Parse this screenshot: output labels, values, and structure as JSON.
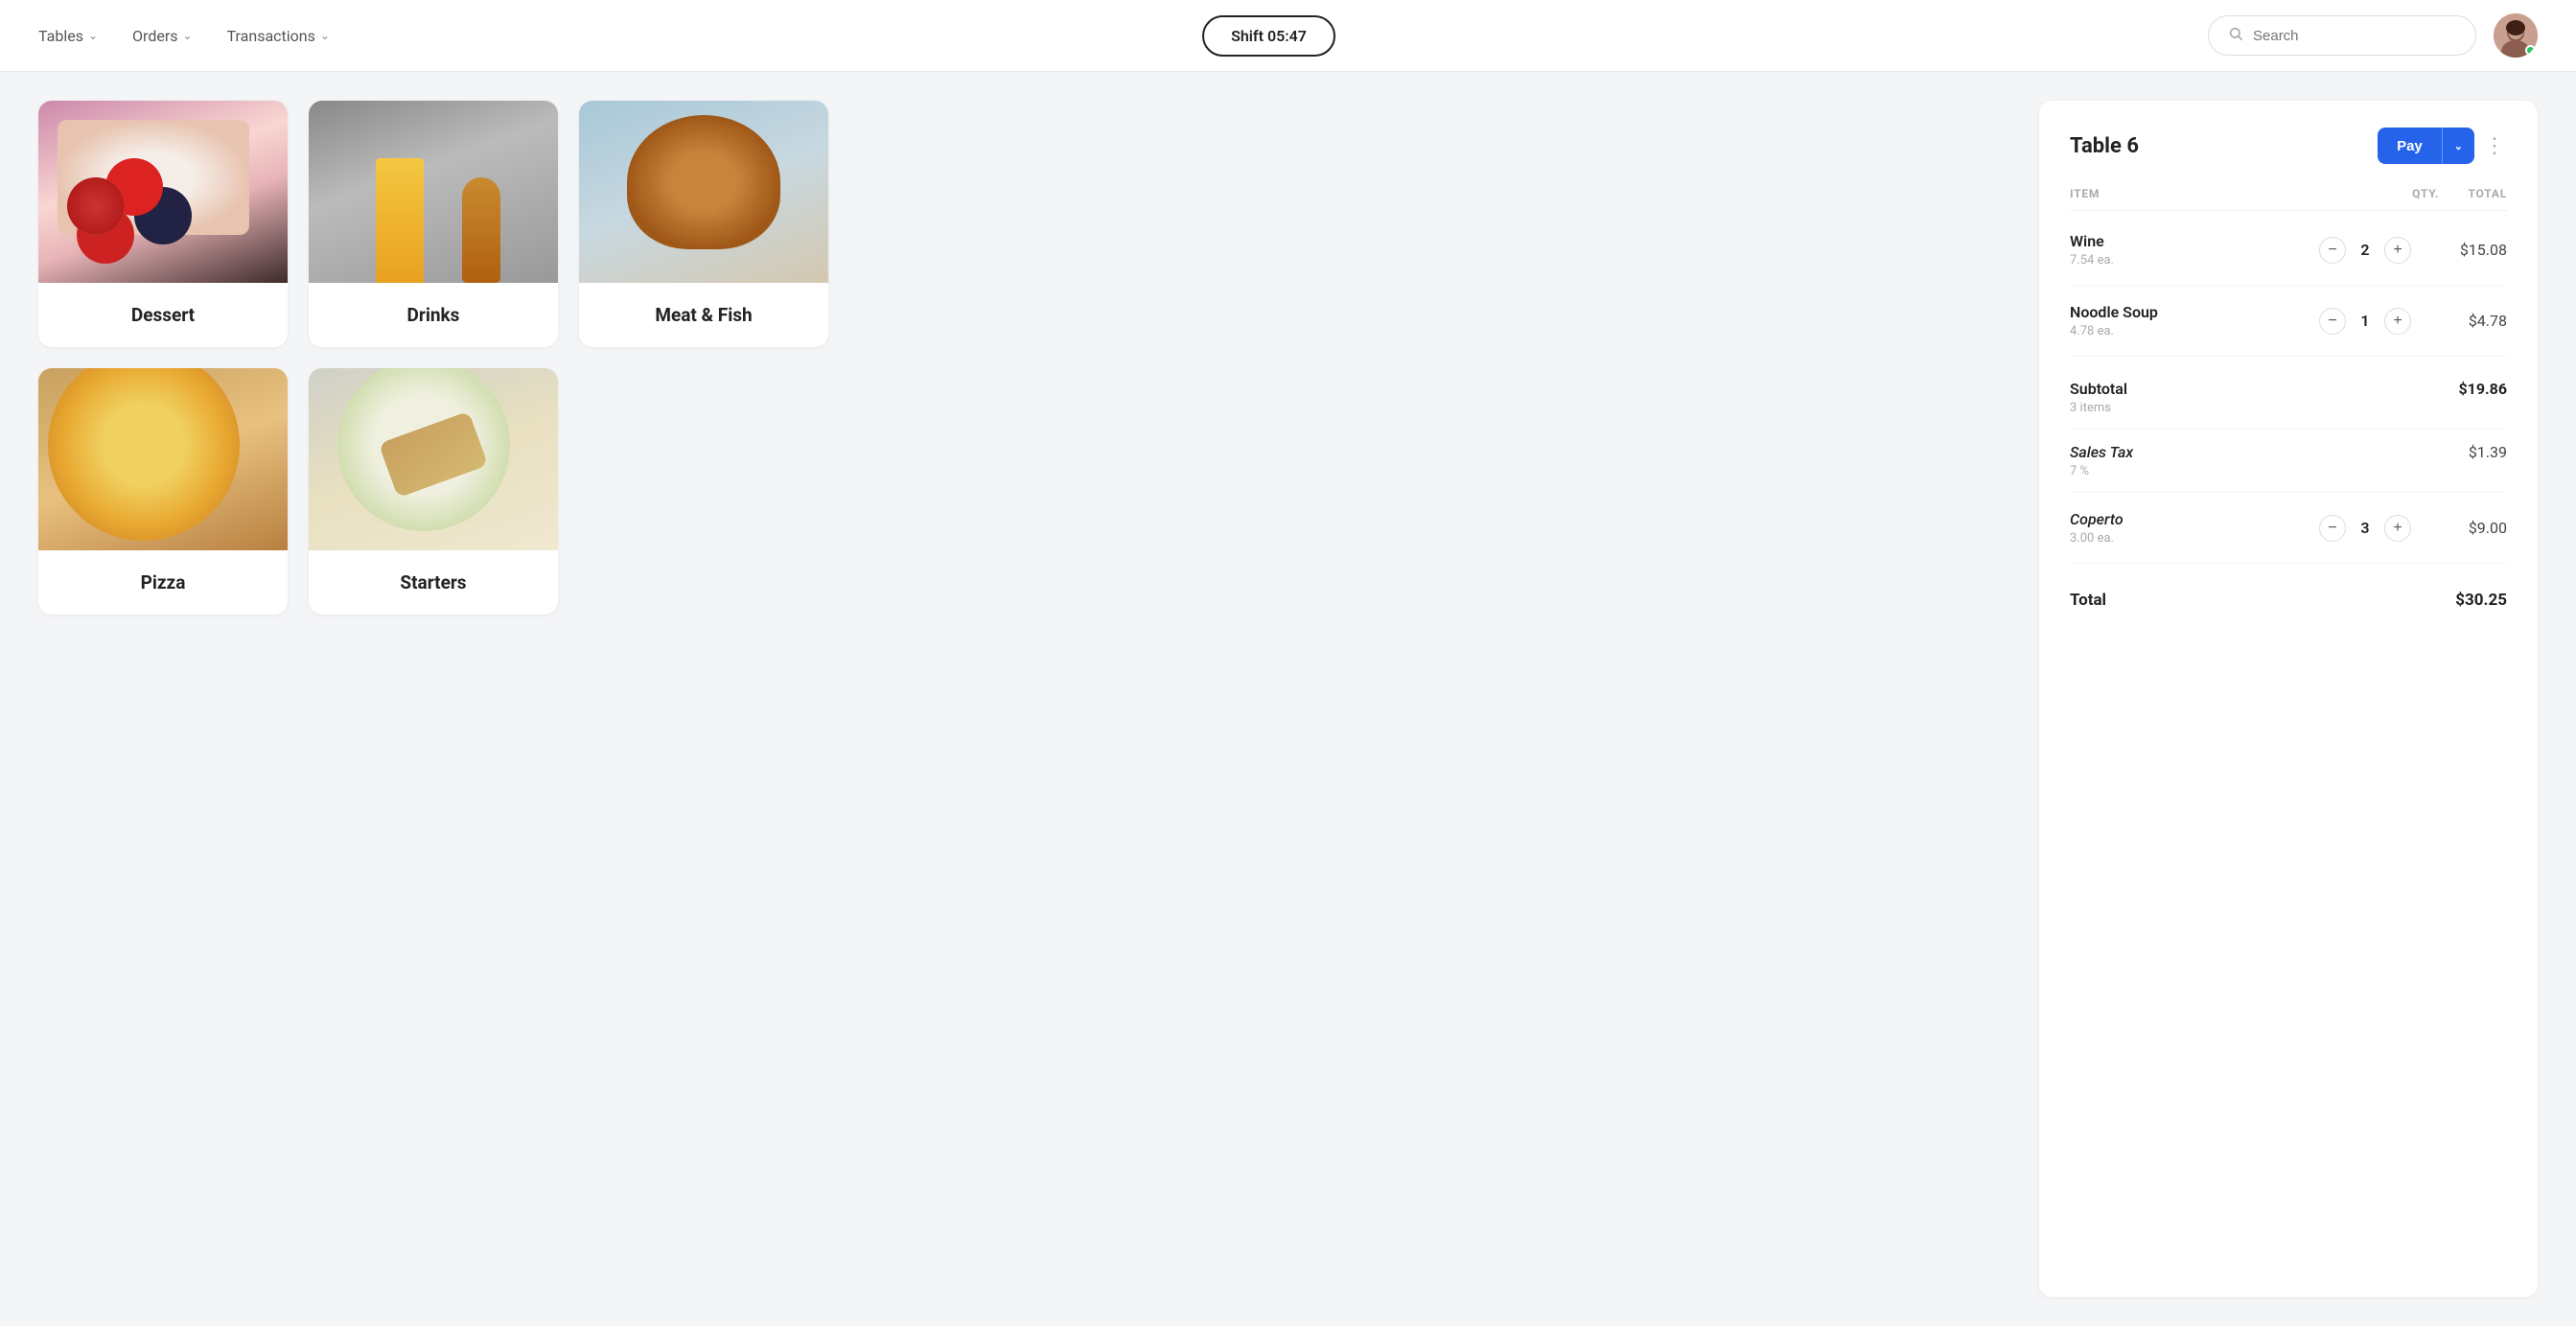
{
  "header": {
    "nav": [
      {
        "label": "Tables",
        "id": "tables"
      },
      {
        "label": "Orders",
        "id": "orders"
      },
      {
        "label": "Transactions",
        "id": "transactions"
      }
    ],
    "shift_label": "Shift 05:47",
    "search_placeholder": "Search"
  },
  "categories": [
    {
      "id": "dessert",
      "label": "Dessert",
      "img_class": "img-dessert"
    },
    {
      "id": "drinks",
      "label": "Drinks",
      "img_class": "img-drinks"
    },
    {
      "id": "meatfish",
      "label": "Meat & Fish",
      "img_class": "img-meatfish"
    },
    {
      "id": "pizza",
      "label": "Pizza",
      "img_class": "img-pizza"
    },
    {
      "id": "starters",
      "label": "Starters",
      "img_class": "img-starters"
    }
  ],
  "order": {
    "table_title": "Table 6",
    "pay_label": "Pay",
    "columns": {
      "item": "ITEM",
      "qty": "QTY.",
      "total": "TOTAL"
    },
    "items": [
      {
        "name": "Wine",
        "price": "7.54 ea.",
        "qty": 2,
        "total": "$15.08"
      },
      {
        "name": "Noodle Soup",
        "price": "4.78 ea.",
        "qty": 1,
        "total": "$4.78"
      }
    ],
    "subtotal": {
      "label": "Subtotal",
      "sublabel": "3 items",
      "value": "$19.86"
    },
    "sales_tax": {
      "label": "Sales Tax",
      "sublabel": "7 %",
      "value": "$1.39"
    },
    "coperto": {
      "label": "Coperto",
      "sublabel": "3.00 ea.",
      "qty": 3,
      "value": "$9.00"
    },
    "total": {
      "label": "Total",
      "value": "$30.25"
    }
  }
}
